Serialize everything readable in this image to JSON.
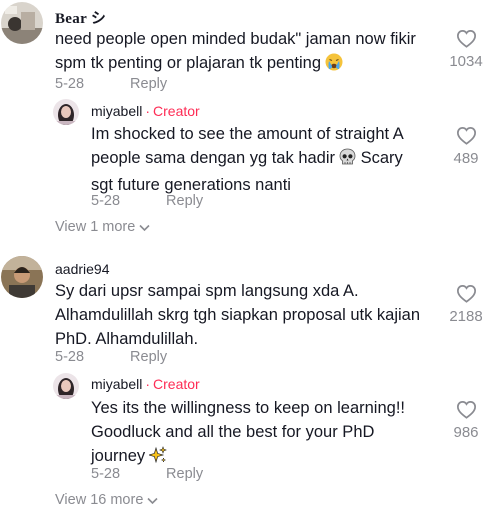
{
  "threads": [
    {
      "comment": {
        "username": "Bear",
        "username_suffix": "シ",
        "text": "need people open minded budak\" jaman now fikir spm tk penting or plajaran tk penting",
        "emoji_icon": "crying-face-emoji",
        "date": "5-28",
        "reply_label": "Reply",
        "likes": "1034"
      },
      "reply": {
        "username": "miyabell",
        "separator": "·",
        "creator_label": "Creator",
        "text": "Im shocked to see the amount of straight A people sama dengan yg tak hadir",
        "emoji_icon": "skull-emoji",
        "text_after": "Scary sgt future generations nanti",
        "date": "5-28",
        "reply_label": "Reply",
        "likes": "489"
      },
      "view_more": "View 1 more"
    },
    {
      "comment": {
        "username": "aadrie94",
        "text": "Sy dari upsr sampai spm langsung xda A. Alhamdulillah skrg tgh siapkan proposal utk kajian PhD. Alhamdulillah.",
        "date": "5-28",
        "reply_label": "Reply",
        "likes": "2188"
      },
      "reply": {
        "username": "miyabell",
        "separator": "·",
        "creator_label": "Creator",
        "text": "Yes its the willingness to keep on learning!! Goodluck and all the best for your PhD journey",
        "emoji_icon": "sparkles-emoji",
        "date": "5-28",
        "reply_label": "Reply",
        "likes": "986"
      },
      "view_more": "View 16 more"
    }
  ],
  "icons": {
    "like": "heart-outline-icon",
    "expand": "chevron-down-icon"
  },
  "colors": {
    "text": "#161823",
    "muted": "#8a8b91",
    "creator": "#fe2c55"
  }
}
